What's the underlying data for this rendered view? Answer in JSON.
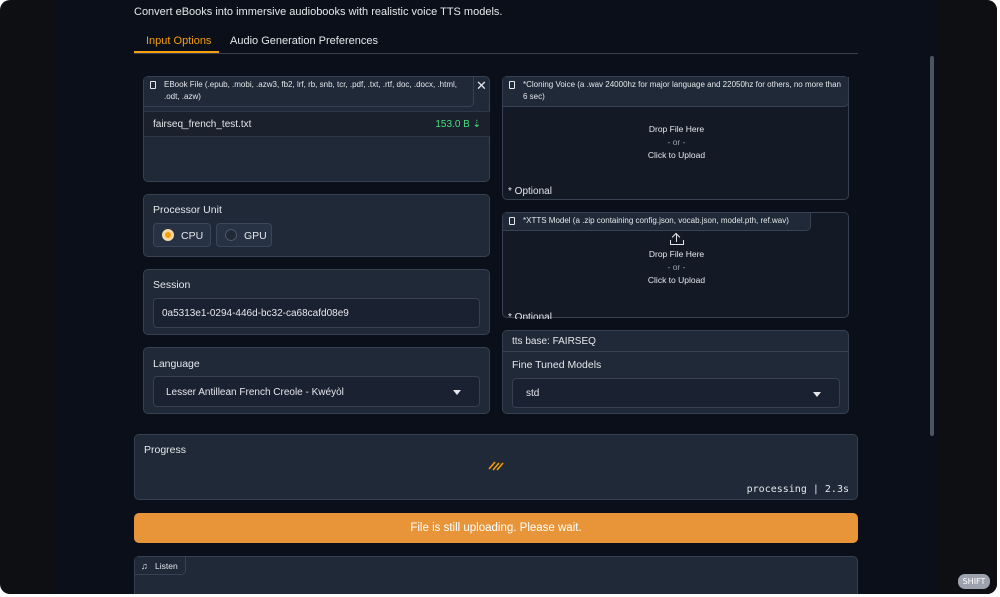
{
  "header": {
    "subtitle": "Convert eBooks into immersive audiobooks with realistic voice TTS models."
  },
  "tabs": [
    {
      "label": "Input Options",
      "active": true
    },
    {
      "label": "Audio Generation Preferences",
      "active": false
    }
  ],
  "ebook": {
    "label": "EBook File (.epub, .mobi, .azw3, fb2, lrf, rb, snb, tcr, .pdf, .txt, .rtf, doc, .docx, .html, .odt, .azw)",
    "file_name": "fairseq_french_test.txt",
    "file_size": "153.0 B ⇣"
  },
  "cloning_voice": {
    "label": "*Cloning Voice (a .wav 24000hz for major language and 22050hz for others, no more than 6 sec)",
    "drop_text": "Drop File Here",
    "or_text": "- or -",
    "click_text": "Click to Upload",
    "optional": "* Optional"
  },
  "processor": {
    "label": "Processor Unit",
    "options": [
      {
        "label": "CPU",
        "selected": true
      },
      {
        "label": "GPU",
        "selected": false
      }
    ]
  },
  "xtts_model": {
    "label": "*XTTS Model (a .zip containing config.json, vocab.json, model.pth, ref.wav)",
    "drop_text": "Drop File Here",
    "or_text": "- or -",
    "click_text": "Click to Upload",
    "optional": "* Optional"
  },
  "session": {
    "label": "Session",
    "value": "0a5313e1-0294-446d-bc32-ca68cafd08e9"
  },
  "tts_base": {
    "label": "tts base: FAIRSEQ",
    "fine_tuned_label": "Fine Tuned Models",
    "fine_tuned_value": "std"
  },
  "language": {
    "label": "Language",
    "value": "Lesser Antillean French Creole - Kwéyòl"
  },
  "progress": {
    "label": "Progress",
    "status": "processing | 2.3s"
  },
  "banner": {
    "text": "File is still uploading. Please wait."
  },
  "listen": {
    "label": "Listen"
  },
  "watermark": "SHIFT",
  "colors": {
    "accent": "#f59e0b",
    "banner": "#e8953a",
    "file_size": "#4ade80",
    "panel": "#1f2937",
    "background": "#0b0f19"
  }
}
